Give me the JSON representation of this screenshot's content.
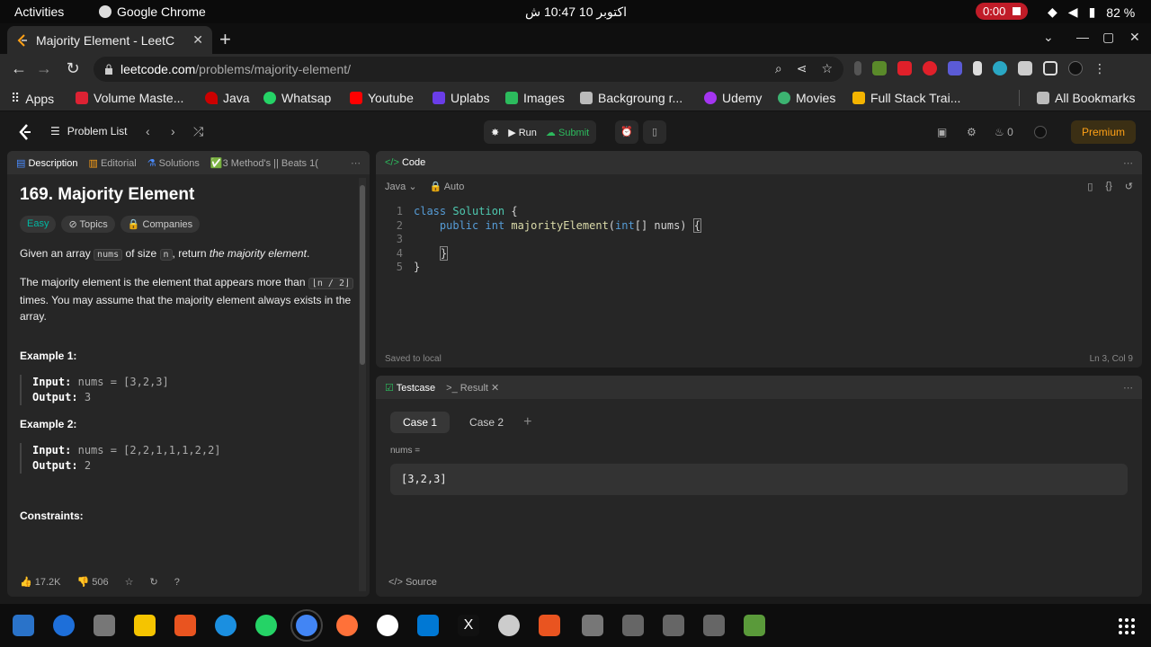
{
  "system": {
    "activities": "Activities",
    "app_name": "Google Chrome",
    "clock": "اکتوبر 10  10:47 ش",
    "recording": "0:00",
    "battery": "82 %"
  },
  "browser": {
    "tab_title": "Majority Element - LeetC",
    "url_host": "leetcode.com",
    "url_path": "/problems/majority-element/",
    "bookmarks": [
      "Apps",
      "Volume Maste...",
      "Java",
      "Whatsap",
      "Youtube",
      "Uplabs",
      "Images",
      "Backgroung r...",
      "Udemy",
      "Movies",
      "Full Stack Trai...",
      "All Bookmarks"
    ]
  },
  "lc_nav": {
    "problem_list": "Problem List",
    "run": "Run",
    "submit": "Submit",
    "streak": "0",
    "premium": "Premium"
  },
  "left_tabs": [
    "Description",
    "Editorial",
    "Solutions",
    "✅3 Method's || Beats 1("
  ],
  "problem": {
    "title": "169. Majority Element",
    "difficulty": "Easy",
    "topics": "Topics",
    "companies": "Companies",
    "p1_a": "Given an array ",
    "p1_code1": "nums",
    "p1_b": " of size ",
    "p1_code2": "n",
    "p1_c": ", return ",
    "p1_em": "the majority element",
    "p1_d": ".",
    "p2_a": "The majority element is the element that appears more than ",
    "p2_code": "⌊n / 2⌋",
    "p2_b": " times. You may assume that the majority element always exists in the array.",
    "ex1_title": "Example 1:",
    "ex1_input": "nums = [3,2,3]",
    "ex1_output": "3",
    "ex2_title": "Example 2:",
    "ex2_input": "nums = [2,2,1,1,1,2,2]",
    "ex2_output": "2",
    "input_label": "Input:",
    "output_label": "Output:",
    "constraints": "Constraints:",
    "likes": "17.2K",
    "dislikes": "506"
  },
  "code_panel": {
    "tab": "Code",
    "language": "Java",
    "mode": "Auto",
    "lines": [
      "1",
      "2",
      "3",
      "4",
      "5"
    ],
    "saved": "Saved to local",
    "cursor": "Ln 3, Col 9"
  },
  "test_panel": {
    "tab_testcase": "Testcase",
    "tab_result": "Result",
    "case1": "Case 1",
    "case2": "Case 2",
    "var": "nums =",
    "value": "[3,2,3]",
    "source": "Source"
  },
  "colors": {
    "accent_orange": "#ffa116",
    "easy": "#00b8a3",
    "submit_green": "#2cbb5d"
  }
}
